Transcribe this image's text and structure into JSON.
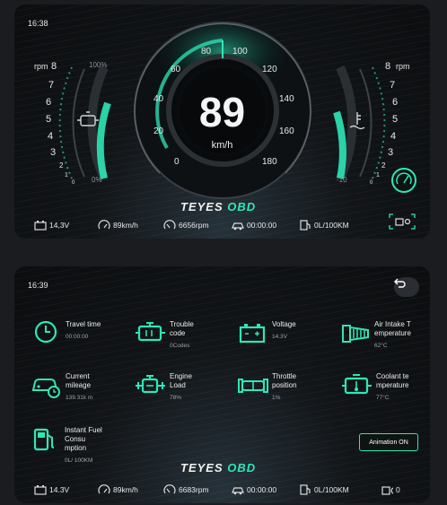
{
  "panel1": {
    "time": "16:38",
    "speed": "89",
    "speed_unit": "km/h",
    "speed_ticks": [
      "0",
      "20",
      "40",
      "60",
      "80",
      "100",
      "120",
      "140",
      "160",
      "180"
    ],
    "rpm_label": "rpm",
    "rpm_ticks": [
      "8",
      "7",
      "6",
      "5",
      "4",
      "3",
      "2",
      "1",
      "0"
    ],
    "rpm_label_right": "rpm",
    "temp_ticks_right": [
      "8",
      "7",
      "6",
      "5",
      "4",
      "3",
      "2",
      "1",
      "0"
    ],
    "fuel_top": "100%",
    "fuel_bottom": "0%",
    "temp_bottom": "-10",
    "brand_main": "TEYES",
    "brand_obd": "OBD",
    "status": {
      "voltage": "14,3V",
      "speed": "89km/h",
      "rpm": "6656rpm",
      "time": "00:00:00",
      "fuel": "0L/100KM"
    }
  },
  "panel2": {
    "time": "16:39",
    "items": [
      {
        "label": "Travel time",
        "value": "00:00:00",
        "icon": "clock-icon"
      },
      {
        "label": "Trouble code",
        "value": "0Codes",
        "icon": "engine-icon"
      },
      {
        "label": "Voltage",
        "value": "14.3V",
        "icon": "battery-icon"
      },
      {
        "label": "Air Intake T emperature",
        "value": "62°C",
        "icon": "air-intake-icon"
      },
      {
        "label": "Current mileage",
        "value": "139.31k m",
        "icon": "car-mileage-icon"
      },
      {
        "label": "Engine Load",
        "value": "78%",
        "icon": "engine-load-icon"
      },
      {
        "label": "Throttle position",
        "value": "1%",
        "icon": "throttle-icon"
      },
      {
        "label": "Coolant te mperature",
        "value": "77°C",
        "icon": "coolant-icon"
      },
      {
        "label": "Instant Fuel Consu mption",
        "value": "0L/ 100KM",
        "icon": "fuel-pump-icon"
      }
    ],
    "animation_button": "Animation ON",
    "brand_main": "TEYES",
    "brand_obd": "OBD",
    "status": {
      "voltage": "14.3V",
      "speed": "89km/h",
      "rpm": "6683rpm",
      "time": "00:00:00",
      "fuel": "0L/100KM",
      "obd_count": "0"
    }
  },
  "colors": {
    "accent": "#2ee7b7",
    "background": "#0b0d0f"
  }
}
